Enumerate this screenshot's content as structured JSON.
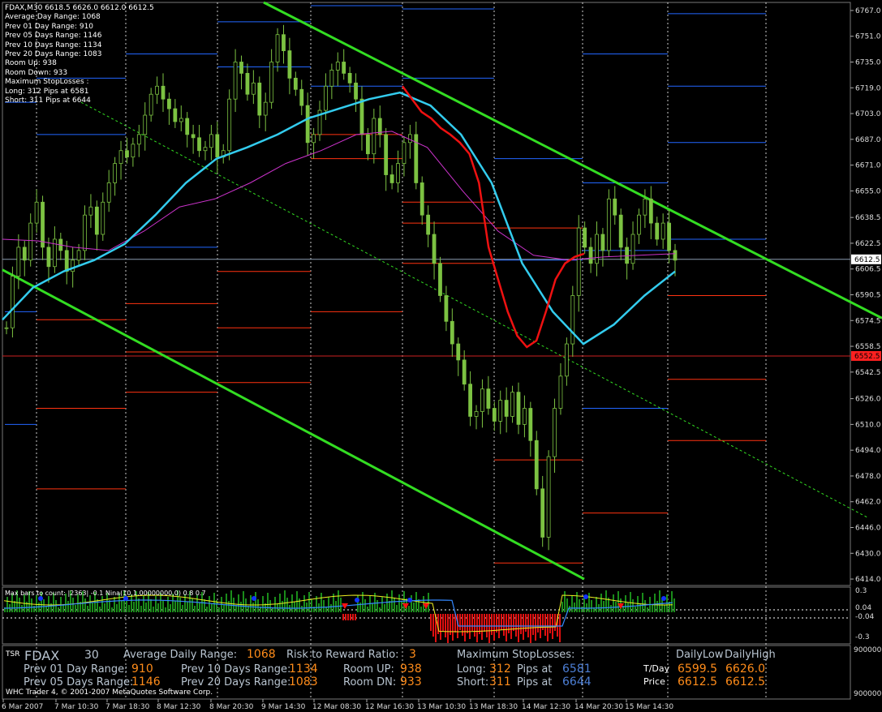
{
  "header": {
    "symbol_line": "FDAX,M30  6618.5 6626.0 6612.0 6612.5",
    "stats": [
      "Average Day  Range: 1068",
      "Prev 01  Day  Range: 910",
      "Prev 05  Days Range: 1146",
      "Prev 10  Days Range: 1134",
      "Prev 20  Days Range: 1083",
      "Room Up:    938",
      "Room Down: 933",
      "Maximum StopLosses :",
      "Long:  312 Pips at 6581",
      "Short: 311 Pips at 6644"
    ]
  },
  "price_axis": {
    "ticks": [
      "6767.0",
      "6751.0",
      "6735.0",
      "6719.0",
      "6703.0",
      "6687.0",
      "6671.0",
      "6655.0",
      "6638.5",
      "6622.5",
      "6606.5",
      "6590.5",
      "6574.5",
      "6558.5",
      "6542.5",
      "6526.0",
      "6510.0",
      "6494.0",
      "6478.0",
      "6462.0",
      "6446.0",
      "6430.0",
      "6414.0"
    ],
    "current_label": "6612.5",
    "current_label_color": "#ffffff",
    "level_label": "6552.5",
    "level_label_color": "#ff2020"
  },
  "indicator_axis": {
    "ticks": [
      "0.3",
      "0.04",
      "-0.04",
      "-0.3"
    ],
    "label": "Max bars to count: |2363| -0.1  Nina(10,1.00000000,0) 0.8 0.7"
  },
  "volume_axis": {
    "ticks": [
      "900000",
      "9000000"
    ]
  },
  "time_axis": {
    "ticks": [
      "6 Mar 2007",
      "7 Mar 10:30",
      "7 Mar 18:30",
      "8 Mar 12:30",
      "8 Mar 20:30",
      "9 Mar 14:30",
      "12 Mar 08:30",
      "12 Mar 16:30",
      "13 Mar 10:30",
      "13 Mar 18:30",
      "14 Mar 12:30",
      "14 Mar 20:30",
      "15 Mar 14:30"
    ]
  },
  "tsr_panel": {
    "tag": "TSR",
    "symbol": "FDAX",
    "timeframe": "30",
    "avg_label": "Average Daily Range:",
    "avg_value": "1068",
    "rr_label": "Risk to Reward Ratio:",
    "rr_value": "3",
    "msl_label": "Maximum StopLosses:",
    "daily_low_label": "DailyLow",
    "daily_high_label": "DailyHigh",
    "prev01_label": "Prev 01 Day Range:",
    "prev01_value": "910",
    "prev10_label": "Prev 10 Days Range:",
    "prev10_value": "1134",
    "roomup_label": "Room UP:",
    "roomup_value": "938",
    "long_label": "Long:",
    "long_pips": "312",
    "pips_at_1": "Pips at",
    "long_at": "6581",
    "tday_label": "T/Day",
    "tday_low": "6599.5",
    "tday_high": "6626.0",
    "prev05_label": "Prev 05 Days Range:",
    "prev05_value": "1146",
    "prev20_label": "Prev 20 Days Range:",
    "prev20_value": "1083",
    "roomdn_label": "Room DN:",
    "roomdn_value": "933",
    "short_label": "Short:",
    "short_pips": "311",
    "pips_at_2": "Pips at",
    "short_at": "6644",
    "price_label": "Price",
    "price_low": "6612.5",
    "price_high": "6612.5",
    "copyright": "WHC Trader 4, © 2001-2007 MetaQuotes Software Corp."
  },
  "colors": {
    "candle": "#7cc242",
    "channel": "#33dd22",
    "ma_fast": "#ee1111",
    "ma_slow": "#33ccee",
    "ma_mid": "#cc33cc",
    "grid": "#ffffff",
    "pivot_blue": "#2266ff",
    "pivot_red": "#ff3311",
    "hist_green": "#1a8c1a",
    "hist_red": "#e01010"
  },
  "chart_data": {
    "type": "candlestick",
    "symbol": "FDAX,M30",
    "ylim": [
      6410,
      6772
    ],
    "close_approx": [
      6570,
      6602,
      6620,
      6612,
      6635,
      6648,
      6620,
      6608,
      6625,
      6618,
      6605,
      6612,
      6618,
      6640,
      6645,
      6628,
      6648,
      6660,
      6672,
      6680,
      6676,
      6684,
      6690,
      6702,
      6715,
      6720,
      6712,
      6706,
      6698,
      6700,
      6690,
      6688,
      6680,
      6682,
      6690,
      6676,
      6680,
      6712,
      6735,
      6728,
      6715,
      6722,
      6702,
      6710,
      6735,
      6752,
      6742,
      6725,
      6718,
      6708,
      6685,
      6690,
      6705,
      6720,
      6730,
      6735,
      6728,
      6722,
      6712,
      6690,
      6678,
      6700,
      6690,
      6665,
      6660,
      6672,
      6685,
      6690,
      6660,
      6640,
      6628,
      6610,
      6590,
      6574,
      6560,
      6550,
      6535,
      6515,
      6518,
      6532,
      6520,
      6512,
      6525,
      6515,
      6530,
      6510,
      6520,
      6500,
      6470,
      6440,
      6490,
      6520,
      6540,
      6560,
      6590,
      6632,
      6620,
      6610,
      6628,
      6618,
      6650,
      6640,
      6620,
      6610,
      6628,
      6640,
      6650,
      6635,
      6625,
      6635,
      6618,
      6612
    ],
    "moving_averages": [
      {
        "name": "fast",
        "color": "#ee1111",
        "values": [
          6720,
          6712,
          6704,
          6700,
          6694,
          6690,
          6685,
          6678,
          6660,
          6620,
          6600,
          6580,
          6565,
          6558,
          6562,
          6580,
          6600,
          6610,
          6614,
          6616
        ]
      },
      {
        "name": "slow",
        "color": "#33ccee",
        "values": [
          6575,
          6595,
          6605,
          6612,
          6622,
          6640,
          6660,
          6675,
          6682,
          6690,
          6700,
          6706,
          6712,
          6716,
          6708,
          6690,
          6660,
          6610,
          6580,
          6560,
          6572,
          6590,
          6605
        ]
      },
      {
        "name": "mid",
        "color": "#cc33cc",
        "values": [
          6625,
          6624,
          6620,
          6618,
          6630,
          6645,
          6650,
          6660,
          6672,
          6680,
          6690,
          6692,
          6682,
          6655,
          6630,
          6615,
          6612,
          6614,
          6615,
          6616
        ]
      }
    ],
    "horizontal_levels": {
      "current": 6612.5,
      "marked": 6552.5
    }
  }
}
